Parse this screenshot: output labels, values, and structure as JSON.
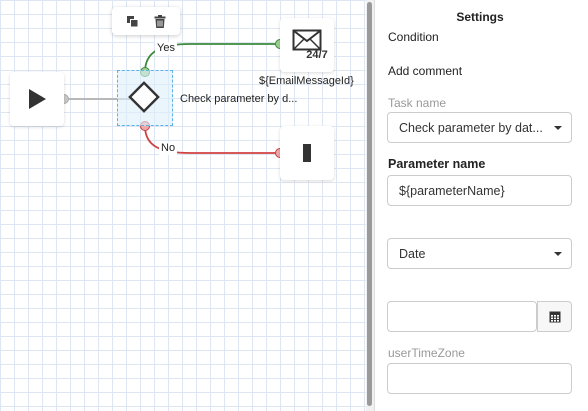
{
  "toolbar": {
    "copy_icon": "copy-icon",
    "delete_icon": "trash-icon"
  },
  "flow": {
    "yes_label": "Yes",
    "no_label": "No",
    "condition_caption": "Check parameter by d...",
    "email_caption": "${EmailMessageId}",
    "email_badge": "24/7",
    "colors": {
      "yes_line": "#3a8a3a",
      "no_line": "#d04040",
      "default_line": "#b8b8b8",
      "selection": "#5bb3e6"
    }
  },
  "settings": {
    "title": "Settings",
    "type_label": "Condition",
    "add_comment": "Add comment",
    "task_name_label": "Task name",
    "task_name_value": "Check parameter by dat...",
    "parameter_name_label": "Parameter name",
    "parameter_name_value": "${parameterName}",
    "type_select_value": "Date",
    "datetime_value": "",
    "user_time_zone_label": "userTimeZone",
    "user_time_zone_value": ""
  }
}
